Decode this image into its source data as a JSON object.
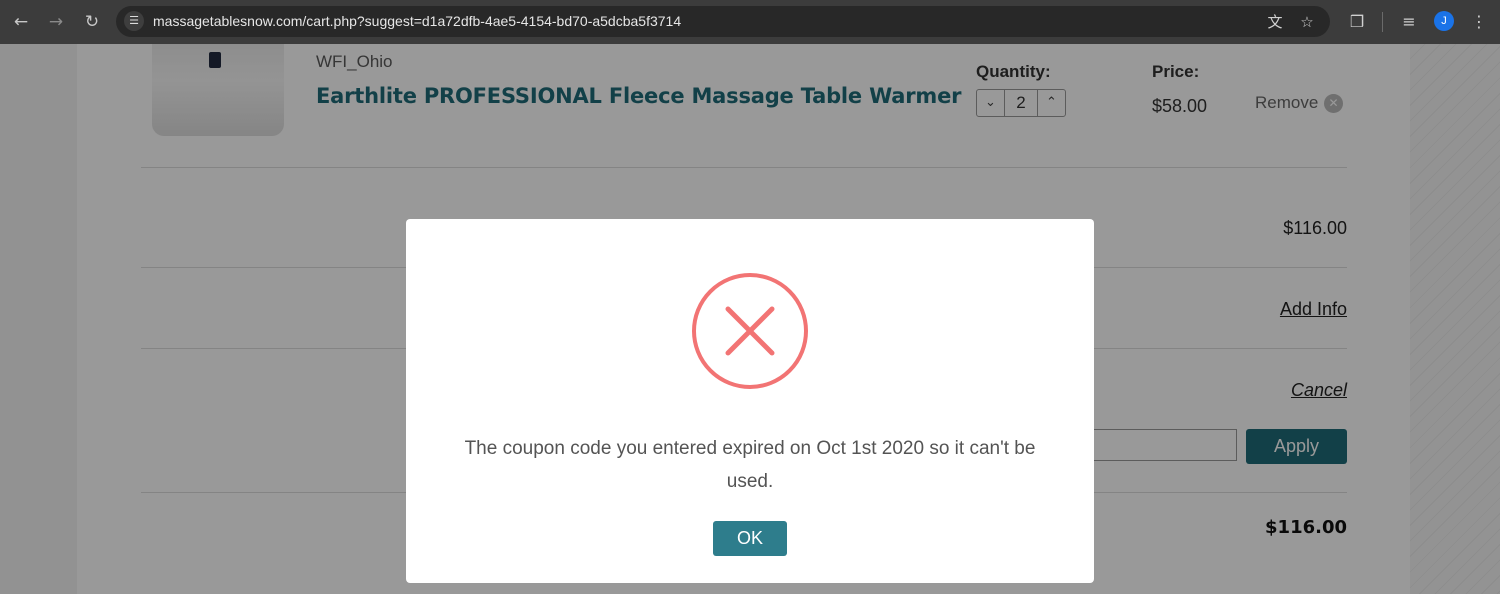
{
  "browser": {
    "url": "massagetablesnow.com/cart.php?suggest=d1a72dfb-4ae5-4154-bd70-a5dcba5f3714",
    "profile_initial": "J",
    "icons": [
      "back-icon",
      "forward-icon",
      "reload-icon",
      "site-info-icon",
      "translate-icon",
      "bookmark-star-icon",
      "extensions-icon",
      "reading-list-icon",
      "menu-icon"
    ]
  },
  "cart": {
    "item": {
      "vendor": "WFI_Ohio",
      "name": "Earthlite PROFESSIONAL Fleece Massage Table Warmer",
      "quantity_label": "Quantity:",
      "quantity": "2",
      "price_label": "Price:",
      "price": "$58.00",
      "remove_label": "Remove"
    },
    "subtotal": "$116.00",
    "add_info_label": "Add Info",
    "cancel_label": "Cancel",
    "coupon_value": "",
    "apply_label": "Apply",
    "total": "$116.00"
  },
  "modal": {
    "message": "The coupon code you entered expired on Oct 1st 2020 so it can't be used.",
    "ok_label": "OK",
    "icon": "error-x-icon"
  },
  "colors": {
    "brand_teal": "#1f6b78",
    "error_red": "#f27474",
    "ok_button": "#2e7d8c",
    "chrome_bg": "#3c3c3c"
  }
}
